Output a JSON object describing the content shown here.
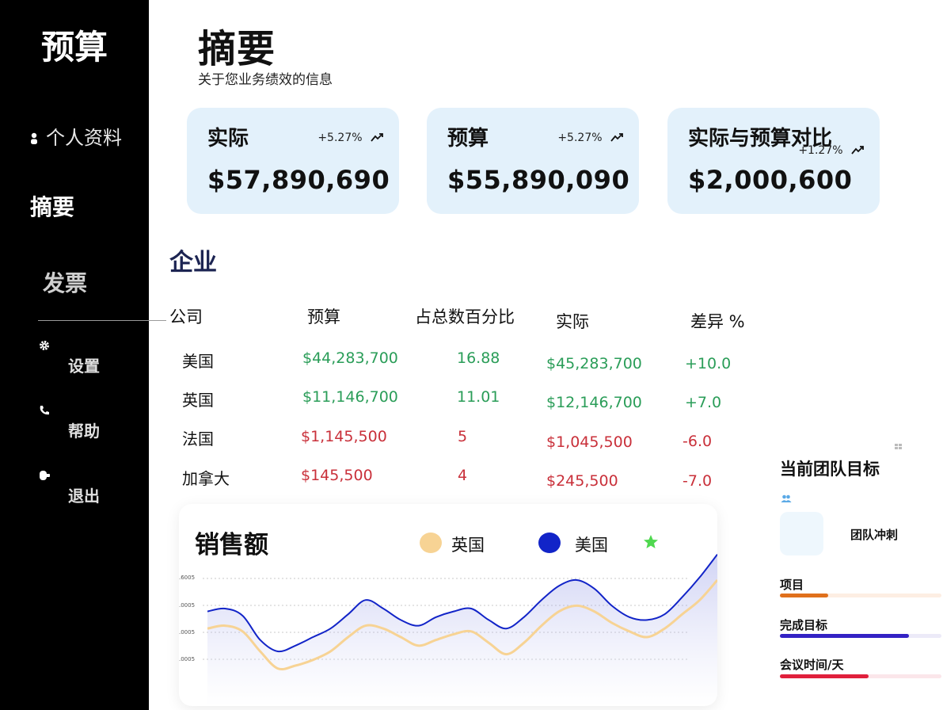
{
  "sidebar": {
    "brand": "预算",
    "nav": {
      "profile": "个人资料",
      "summary": "摘要",
      "invoice": "发票"
    },
    "sub": {
      "settings": "设置",
      "help": "帮助",
      "logout": "退出"
    },
    "icons": [
      "person-icon",
      "gear-icon",
      "phone-icon",
      "logout-icon"
    ]
  },
  "header": {
    "title": "摘要",
    "subtitle": "关于您业务绩效的信息"
  },
  "cards": [
    {
      "label": "实际",
      "change": "+5.27%",
      "value": "$57,890,690"
    },
    {
      "label": "预算",
      "change": "+5.27%",
      "value": "$55,890,090"
    },
    {
      "label": "实际与预算对比",
      "change": "+1.27%",
      "value": "$2,000,600"
    }
  ],
  "companies": {
    "title": "企业",
    "columns": [
      "公司",
      "预算",
      "占总数百分比",
      "实际",
      "差异 %"
    ],
    "rows": [
      {
        "company": "美国",
        "budget": "$44,283,700",
        "percent": "16.88",
        "actual": "$45,283,700",
        "variance": "+10.0"
      },
      {
        "company": "英国",
        "budget": "$11,146,700",
        "percent": "11.01",
        "actual": "$12,146,700",
        "variance": "+7.0"
      },
      {
        "company": "法国",
        "budget": "$1,145,500",
        "percent": "5",
        "actual": "$1,045,500",
        "variance": "-6.0"
      },
      {
        "company": "加拿大",
        "budget": "$145,500",
        "percent": "4",
        "actual": "$245,500",
        "variance": "-7.0"
      }
    ],
    "colors": {
      "positive": "#2a9d58",
      "negative": "#c9303a"
    }
  },
  "sales": {
    "title": "销售额",
    "legend": [
      {
        "label": "英国",
        "color": "#f7d394"
      },
      {
        "label": "美国",
        "color": "#1224c8"
      }
    ],
    "y_ticks": [
      ".6005",
      ".0005",
      ".0005",
      ".0005"
    ],
    "chart_data": {
      "type": "line",
      "series": [
        {
          "name": "美国",
          "values": [
            58,
            60,
            55,
            38,
            30,
            34,
            40,
            46,
            56,
            66,
            60,
            52,
            48,
            54,
            58,
            60,
            52,
            46,
            54,
            66,
            76,
            80,
            74,
            62,
            54,
            52,
            56,
            68,
            82,
            98
          ]
        },
        {
          "name": "英国",
          "values": [
            46,
            48,
            44,
            30,
            18,
            20,
            24,
            30,
            40,
            48,
            46,
            40,
            34,
            38,
            42,
            44,
            36,
            28,
            36,
            48,
            58,
            62,
            58,
            50,
            44,
            40,
            46,
            56,
            66,
            80
          ]
        }
      ],
      "ylim": [
        0,
        100
      ]
    }
  },
  "goals": {
    "title": "当前团队目标",
    "sprint_label": "团队冲刺",
    "items": [
      {
        "label": "项目",
        "progress": 0.3,
        "color": "#e0701c",
        "track": "#fdeee3"
      },
      {
        "label": "完成目标",
        "progress": 0.8,
        "color": "#3322c4",
        "track": "#eceaf8"
      },
      {
        "label": "会议时间/天",
        "progress": 0.55,
        "color": "#e0203c",
        "track": "#fbe6ea"
      }
    ]
  }
}
